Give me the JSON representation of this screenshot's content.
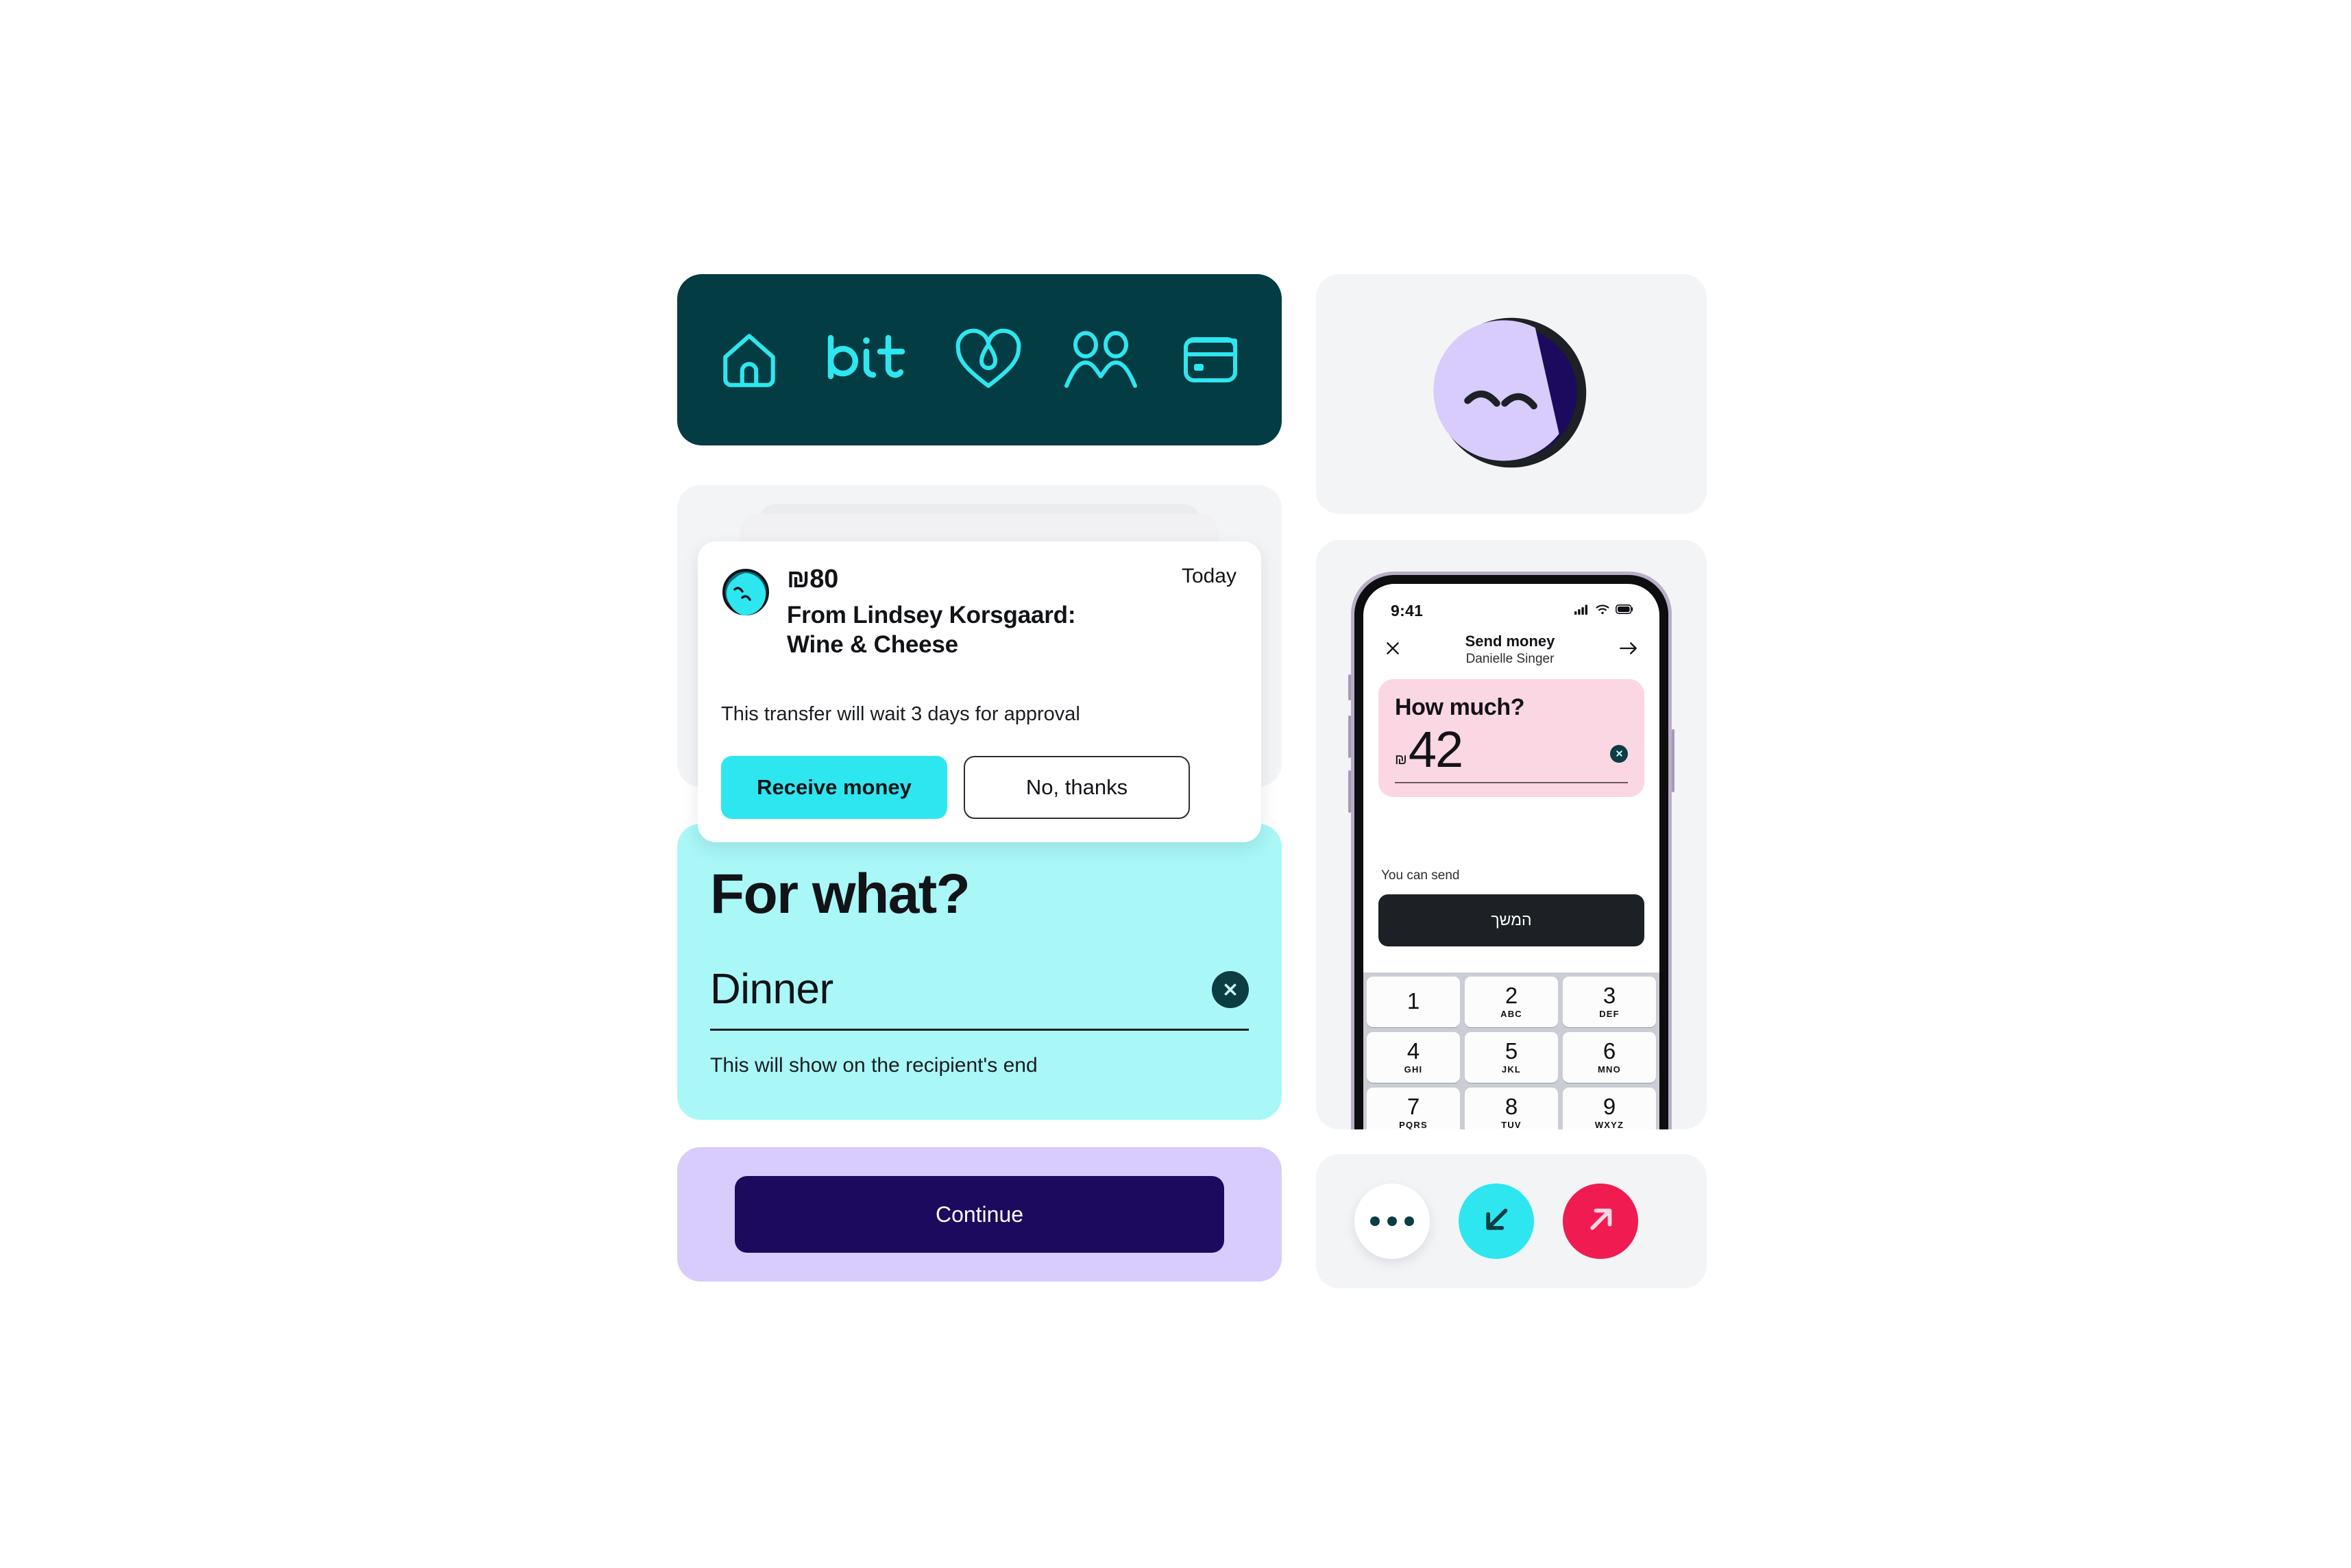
{
  "nav": {
    "icons": [
      {
        "name": "home-icon",
        "label": "Home"
      },
      {
        "name": "bit-wordmark",
        "label": "bit"
      },
      {
        "name": "heart-icon",
        "label": "Favorites"
      },
      {
        "name": "people-icon",
        "label": "Contacts"
      },
      {
        "name": "card-icon",
        "label": "Cards"
      }
    ]
  },
  "notification": {
    "amount": "₪80",
    "date": "Today",
    "from_line1": "From Lindsey Korsgaard:",
    "from_line2": "Wine & Cheese",
    "note": "This transfer will wait 3 days for approval",
    "primary_button": "Receive money",
    "secondary_button": "No, thanks",
    "avatar_name": "lindsey-avatar"
  },
  "for_what": {
    "title": "For what?",
    "value": "Dinner",
    "placeholder": "Dinner",
    "hint": "This will show on the recipient's end",
    "clear_icon": "close-icon"
  },
  "continue": {
    "label": "Continue"
  },
  "phone": {
    "status": {
      "time": "9:41",
      "signal_icon": "signal-bars-icon",
      "wifi_icon": "wifi-icon",
      "battery_icon": "battery-icon"
    },
    "nav": {
      "close_icon": "close-icon",
      "title": "Send money",
      "subtitle": "Danielle Singer",
      "forward_icon": "arrow-right-icon"
    },
    "amount_card": {
      "question": "How much?",
      "currency": "₪",
      "value": "42",
      "clear_icon": "close-icon"
    },
    "balance_label": "You can send",
    "submit_label": "המשך",
    "keypad": [
      [
        {
          "num": "1",
          "sub": ""
        },
        {
          "num": "2",
          "sub": "ABC"
        },
        {
          "num": "3",
          "sub": "DEF"
        }
      ],
      [
        {
          "num": "4",
          "sub": "GHI"
        },
        {
          "num": "5",
          "sub": "JKL"
        },
        {
          "num": "6",
          "sub": "MNO"
        }
      ],
      [
        {
          "num": "7",
          "sub": "PQRS"
        },
        {
          "num": "8",
          "sub": "TUV"
        },
        {
          "num": "9",
          "sub": "WXYZ"
        }
      ]
    ]
  },
  "actions": {
    "more_icon": "ellipsis-icon",
    "receive_icon": "arrow-down-left-icon",
    "send_icon": "arrow-up-right-icon"
  },
  "colors": {
    "brand_dark": "#033c42",
    "brand_cyan": "#2ee6f0",
    "mint": "#a9f7f7",
    "lavender": "#d7ccfb",
    "indigo": "#1c0a5e",
    "pink": "#fbd6e3",
    "crimson": "#ef1b51",
    "panel_gray": "#f3f4f6"
  }
}
